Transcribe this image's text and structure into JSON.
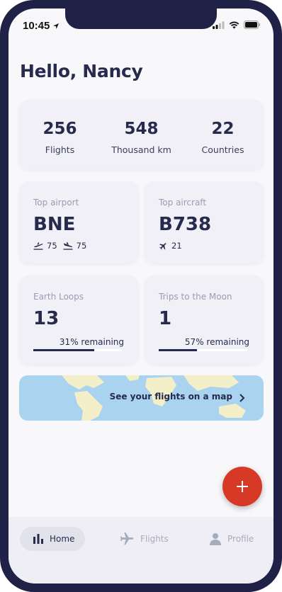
{
  "status_bar": {
    "time": "10:45"
  },
  "greeting": "Hello, Nancy",
  "stats": [
    {
      "value": "256",
      "label": "Flights"
    },
    {
      "value": "548",
      "label": "Thousand km"
    },
    {
      "value": "22",
      "label": "Countries"
    }
  ],
  "top_airport": {
    "label": "Top airport",
    "code": "BNE",
    "departures": "75",
    "arrivals": "75"
  },
  "top_aircraft": {
    "label": "Top aircraft",
    "code": "B738",
    "flights": "21"
  },
  "earth_loops": {
    "label": "Earth Loops",
    "value": "13",
    "remaining_text": "31% remaining",
    "progress_percent": 69
  },
  "moon_trips": {
    "label": "Trips to the Moon",
    "value": "1",
    "remaining_text": "57% remaining",
    "progress_percent": 43
  },
  "map_banner": {
    "text": "See your flights on a map"
  },
  "tabs": [
    {
      "label": "Home",
      "icon": "bar-chart-icon",
      "active": true
    },
    {
      "label": "Flights",
      "icon": "airplane-icon",
      "active": false
    },
    {
      "label": "Profile",
      "icon": "person-icon",
      "active": false
    }
  ],
  "colors": {
    "accent": "#d63a26",
    "primary_text": "#262b4d",
    "frame": "#1f2146",
    "map_sea": "#a9d3ee",
    "map_land": "#f3efc9"
  }
}
